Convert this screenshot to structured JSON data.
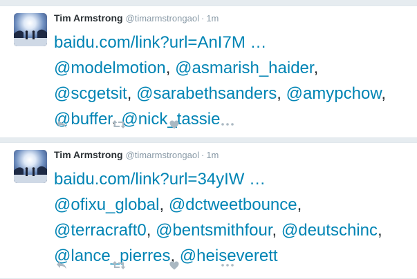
{
  "colors": {
    "link": "#0084b4",
    "name": "#292f33",
    "muted": "#8899a6",
    "icon": "#aab8c2",
    "background": "#e6ecf0"
  },
  "tweets": [
    {
      "fullname": "Tim Armstrong",
      "handle": "@timarmstrongaol",
      "dot": "·",
      "time": "1m",
      "link": "baidu.com/link?url=AnI7M …",
      "mentions": [
        [
          "@modelmotion",
          "@asmarish_haider"
        ],
        [
          "@scgetsit",
          "@sarabethsanders",
          "@amypchow"
        ],
        [
          "@buffer",
          "@nick_tassie"
        ]
      ],
      "separator": ","
    },
    {
      "fullname": "Tim Armstrong",
      "handle": "@timarmstrongaol",
      "dot": "·",
      "time": "1m",
      "link": "baidu.com/link?url=34yIW …",
      "mentions": [
        [
          "@ofixu_global",
          "@dctweetbounce"
        ],
        [
          "@terracraft0",
          "@bentsmithfour",
          "@deutschinc"
        ],
        [
          "@lance_pierres",
          "@heiseverett"
        ]
      ],
      "separator": ","
    }
  ],
  "actions": [
    {
      "name": "reply-icon",
      "label": "Reply"
    },
    {
      "name": "retweet-icon",
      "label": "Retweet"
    },
    {
      "name": "heart-icon",
      "label": "Like"
    },
    {
      "name": "more-icon",
      "label": "More"
    }
  ]
}
